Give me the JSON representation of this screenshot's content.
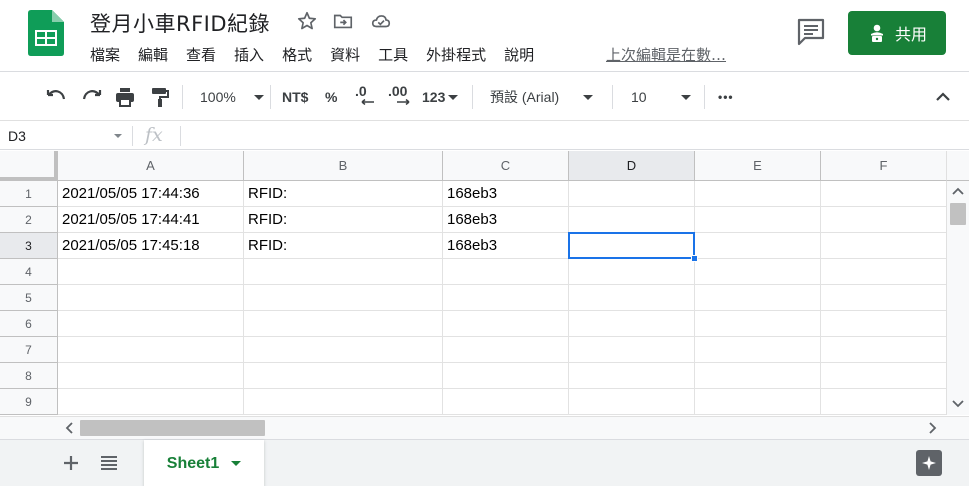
{
  "doc": {
    "title": "登月小車RFID紀錄",
    "last_edit": "上次編輯是在數…"
  },
  "menu": [
    {
      "label": "檔案"
    },
    {
      "label": "編輯"
    },
    {
      "label": "查看"
    },
    {
      "label": "插入"
    },
    {
      "label": "格式"
    },
    {
      "label": "資料"
    },
    {
      "label": "工具"
    },
    {
      "label": "外掛程式"
    },
    {
      "label": "說明"
    }
  ],
  "share": {
    "label": "共用"
  },
  "toolbar": {
    "zoom": "100%",
    "currency": "NT$",
    "percent": "%",
    "decrease_decimal": ".0",
    "increase_decimal": ".00",
    "number_format": "123",
    "font": "預設 (Arial)",
    "font_size": "10",
    "more": "•••"
  },
  "formula_bar": {
    "name_box": "D3",
    "fx": "fx",
    "value": ""
  },
  "grid": {
    "columns": [
      "A",
      "B",
      "C",
      "D",
      "E",
      "F"
    ],
    "selected_column": "D",
    "rows": [
      {
        "num": "1",
        "cells": [
          "2021/05/05 17:44:36",
          "RFID:",
          "168eb3",
          "",
          "",
          ""
        ]
      },
      {
        "num": "2",
        "cells": [
          "2021/05/05 17:44:41",
          "RFID:",
          "168eb3",
          "",
          "",
          ""
        ]
      },
      {
        "num": "3",
        "cells": [
          "2021/05/05 17:45:18",
          "RFID:",
          "168eb3",
          "",
          "",
          ""
        ]
      },
      {
        "num": "4",
        "cells": [
          "",
          "",
          "",
          "",
          "",
          ""
        ]
      },
      {
        "num": "5",
        "cells": [
          "",
          "",
          "",
          "",
          "",
          ""
        ]
      },
      {
        "num": "6",
        "cells": [
          "",
          "",
          "",
          "",
          "",
          ""
        ]
      },
      {
        "num": "7",
        "cells": [
          "",
          "",
          "",
          "",
          "",
          ""
        ]
      },
      {
        "num": "8",
        "cells": [
          "",
          "",
          "",
          "",
          "",
          ""
        ]
      },
      {
        "num": "9",
        "cells": [
          "",
          "",
          "",
          "",
          "",
          ""
        ]
      }
    ],
    "selected_row": "3"
  },
  "sheets": {
    "tabs": [
      {
        "label": "Sheet1"
      }
    ]
  },
  "colors": {
    "brand_green": "#188038",
    "selection_blue": "#1a73e8"
  }
}
